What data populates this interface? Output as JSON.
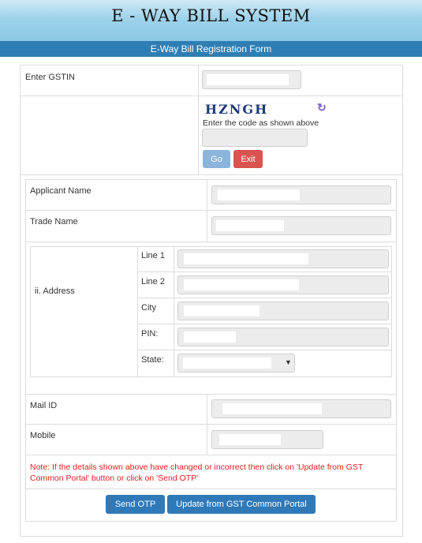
{
  "header": {
    "title": "E - WAY BILL SYSTEM",
    "subtitle": "E-Way Bill Registration Form"
  },
  "gstin": {
    "label": "Enter GSTIN",
    "value": ""
  },
  "captcha": {
    "text": "HZNGH",
    "instruction": "Enter the code as shown above",
    "value": "",
    "refresh_icon": "refresh-icon"
  },
  "buttons": {
    "go": "Go",
    "exit": "Exit",
    "send_otp": "Send OTP",
    "update_portal": "Update from GST Common Portal"
  },
  "applicant": {
    "applicant_name_label": "Applicant Name",
    "trade_name_label": "Trade Name",
    "address_label": "ii. Address",
    "line1_label": "Line 1",
    "line2_label": "Line 2",
    "city_label": "City",
    "pin_label": "PIN:",
    "state_label": "State:",
    "mail_label": "Mail ID",
    "mobile_label": "Mobile"
  },
  "note": "Note: If the details shown above have changed or incorrect then click on 'Update from GST Common Portal' button or click on 'Send OTP'",
  "colors": {
    "header_bar": "#2f7eb3",
    "go_button": "#8ab4dc",
    "exit_button": "#d9534f",
    "primary_button": "#2f79b9",
    "note_text": "#e0201e"
  }
}
